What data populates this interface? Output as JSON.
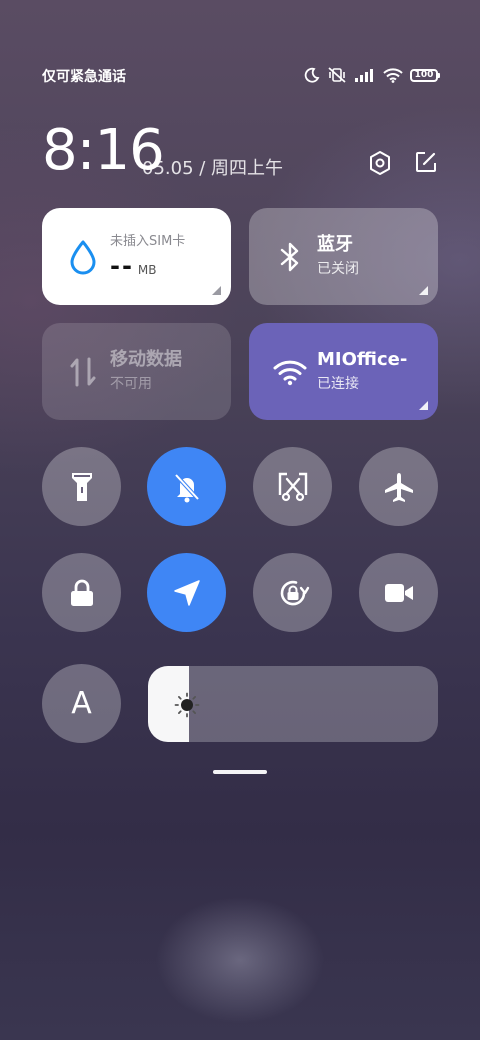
{
  "status_bar": {
    "carrier": "仅可紧急通话",
    "battery": "100"
  },
  "clock": {
    "time": "8:16",
    "date": "05.05 / 周四上午"
  },
  "tiles": {
    "data": {
      "label": "未插入SIM卡",
      "value": "--",
      "unit": "MB"
    },
    "bluetooth": {
      "title": "蓝牙",
      "sub": "已关闭"
    },
    "mobile": {
      "title": "移动数据",
      "sub": "不可用"
    },
    "wifi": {
      "title": "MIOffice-",
      "sub": "已连接"
    }
  },
  "toggles_row1": [
    {
      "icon": "flashlight-icon",
      "active": false
    },
    {
      "icon": "mute-bell-icon",
      "active": true
    },
    {
      "icon": "screenshot-icon",
      "active": false
    },
    {
      "icon": "airplane-icon",
      "active": false
    }
  ],
  "toggles_row2": [
    {
      "icon": "lock-icon",
      "active": false
    },
    {
      "icon": "location-icon",
      "active": true
    },
    {
      "icon": "rotation-lock-icon",
      "active": false
    },
    {
      "icon": "video-camera-icon",
      "active": false
    }
  ],
  "brightness": {
    "auto_label": "A",
    "level_percent": 14
  },
  "colors": {
    "active": "#3f86f5",
    "wifi_tile": "#6b63b8",
    "data_icon": "#1a8ff0"
  }
}
